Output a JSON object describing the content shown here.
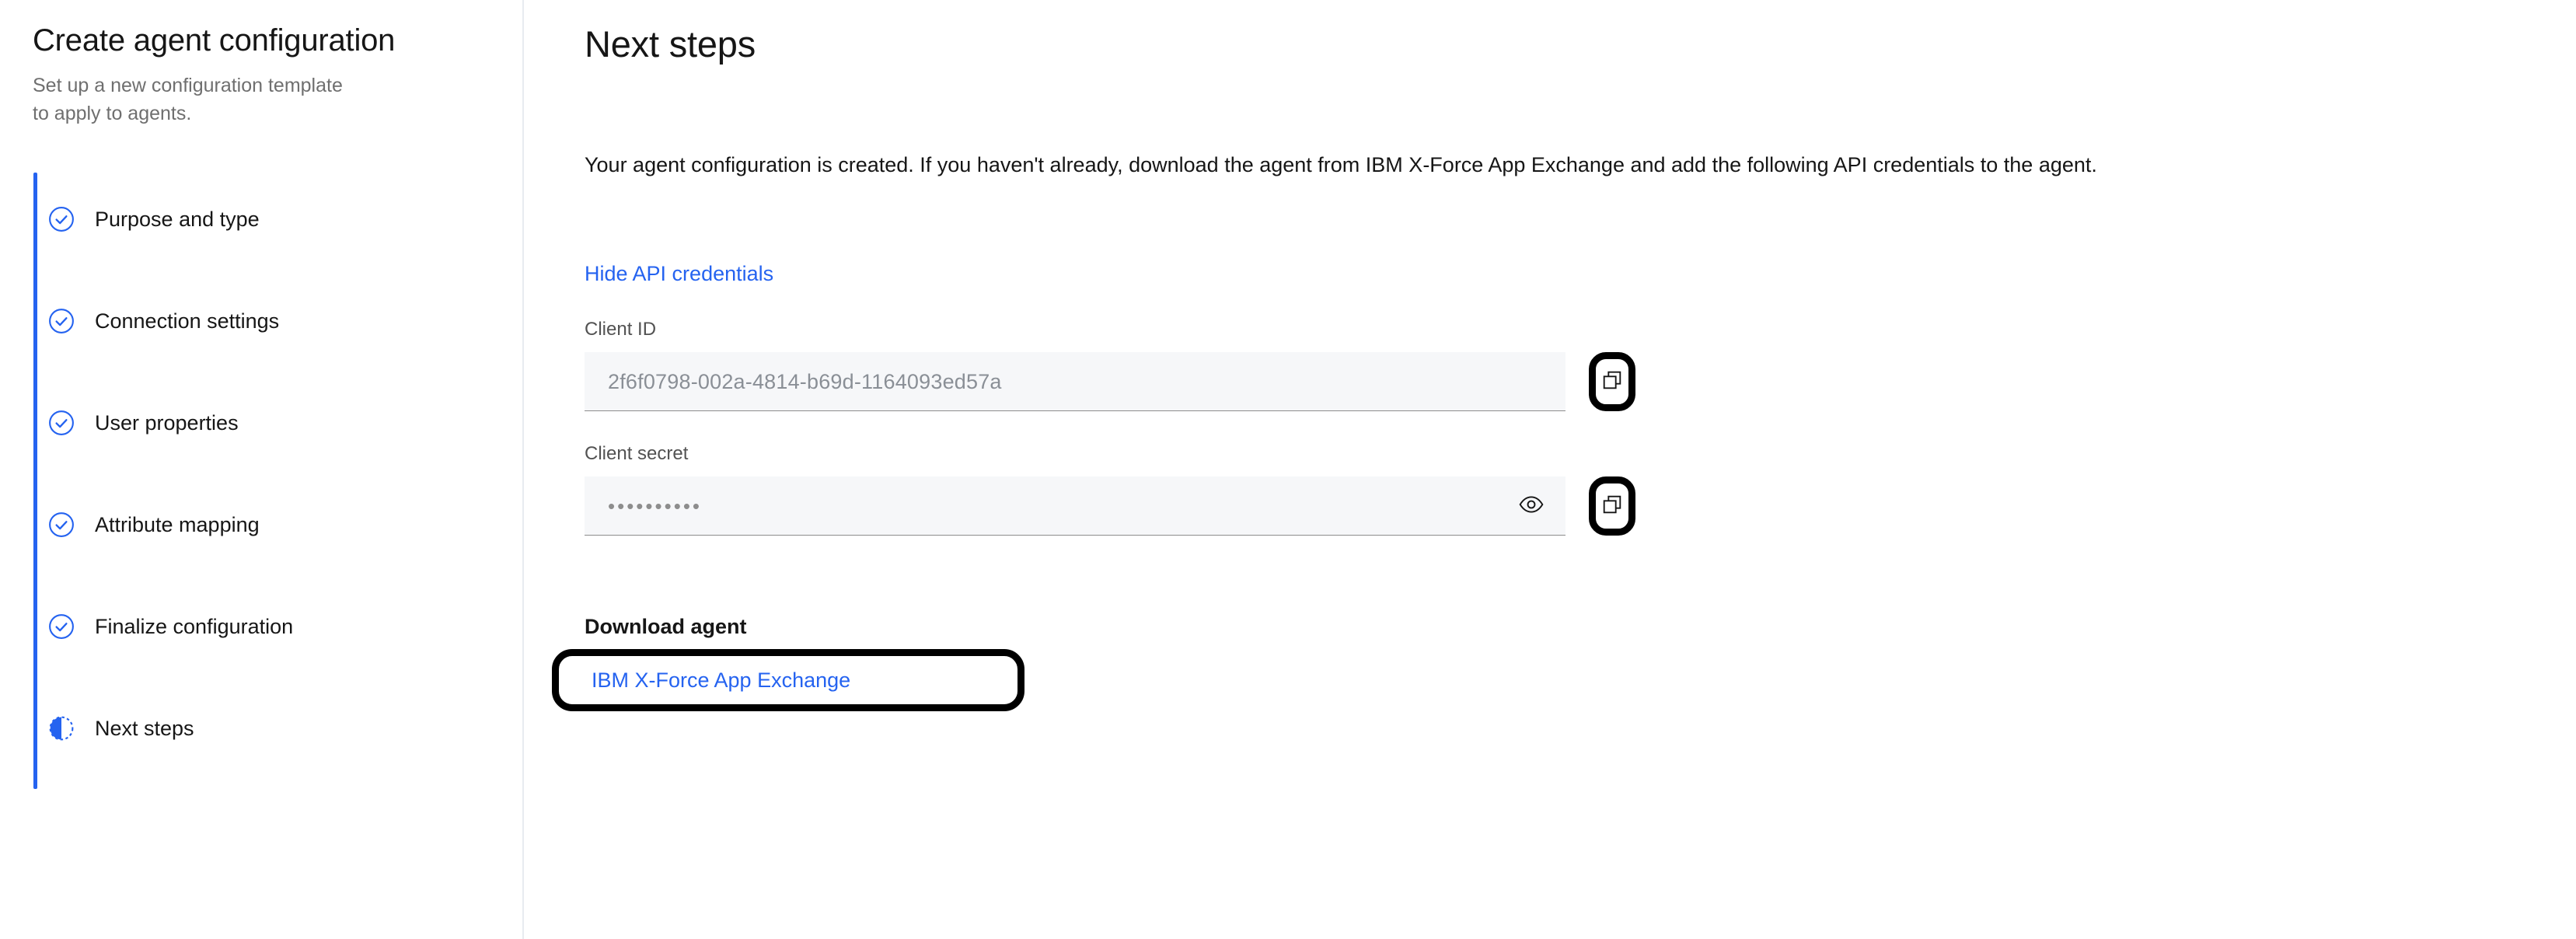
{
  "sidebar": {
    "title": "Create agent configuration",
    "subtitle": "Set up a new configuration template to apply to agents.",
    "items": [
      {
        "label": "Purpose and type",
        "icon": "check-circle-icon",
        "state": "complete"
      },
      {
        "label": "Connection settings",
        "icon": "check-circle-icon",
        "state": "complete"
      },
      {
        "label": "User properties",
        "icon": "check-circle-icon",
        "state": "complete"
      },
      {
        "label": "Attribute mapping",
        "icon": "check-circle-icon",
        "state": "complete"
      },
      {
        "label": "Finalize configuration",
        "icon": "check-circle-icon",
        "state": "complete"
      },
      {
        "label": "Next steps",
        "icon": "in-progress-icon",
        "state": "current"
      }
    ]
  },
  "main": {
    "title": "Next steps",
    "intro": "Your agent configuration is created. If you haven't already, download the agent from IBM X-Force App Exchange and add the following API credentials to the agent.",
    "toggle_credentials_label": "Hide API credentials",
    "fields": {
      "client_id": {
        "label": "Client ID",
        "value": "2f6f0798-002a-4814-b69d-1164093ed57a",
        "copy_icon": "copy-icon"
      },
      "client_secret": {
        "label": "Client secret",
        "value": "••••••••••",
        "reveal_icon": "eye-icon",
        "copy_icon": "copy-icon"
      }
    },
    "download": {
      "heading": "Download agent",
      "link_label": "IBM X-Force App Exchange"
    }
  },
  "colors": {
    "accent_blue": "#2563f0",
    "link_blue": "#2563f0",
    "text_primary": "#161616",
    "text_secondary": "#6f6f6f",
    "field_background": "#f6f7f9",
    "field_underline": "#8d8d8d",
    "annotation_outline": "#000000",
    "divider": "#e8ebf0"
  }
}
